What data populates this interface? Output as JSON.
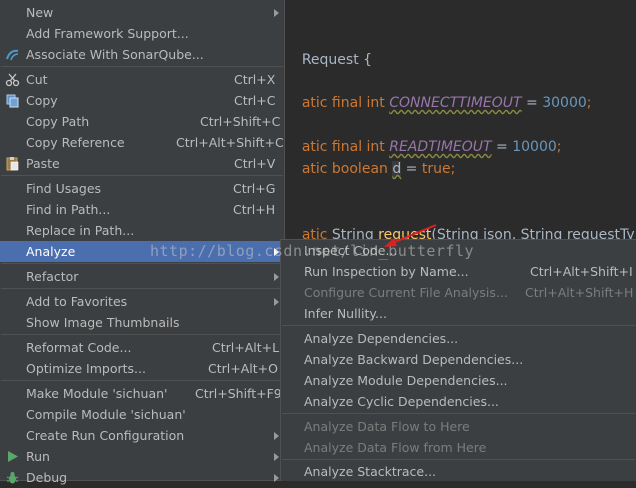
{
  "editor": {
    "line1": "Request {",
    "line2_kw": "atic final int ",
    "line2_const": "CONNECTTIMEOUT",
    "line2_eq": " = ",
    "line2_num": "30000",
    "line2_end": ";",
    "line3_kw": "atic final int ",
    "line3_const": "READTIMEOUT",
    "line3_eq": " = ",
    "line3_num": "10000",
    "line3_end": ";",
    "line4_kw": "atic boolean ",
    "line4_var": "d",
    "line4_eq": " = ",
    "line4_val": "true",
    "line4_end": ";",
    "line5_kw": "atic ",
    "line5_type": "String ",
    "line5_fn": "request",
    "line5_rest": "(String json, String requestType"
  },
  "main_menu": [
    {
      "label": "New",
      "shortcut": "",
      "arrow": true
    },
    {
      "label": "Add Framework Support...",
      "shortcut": ""
    },
    {
      "label": "Associate With SonarQube...",
      "shortcut": "",
      "icon": "sonarqube-icon"
    },
    {
      "label": "Cut",
      "shortcut": "Ctrl+X",
      "icon": "scissors-icon"
    },
    {
      "label": "Copy",
      "shortcut": "Ctrl+C",
      "icon": "copy-icon"
    },
    {
      "label": "Copy Path",
      "shortcut": "Ctrl+Shift+C"
    },
    {
      "label": "Copy Reference",
      "shortcut": "Ctrl+Alt+Shift+C"
    },
    {
      "label": "Paste",
      "shortcut": "Ctrl+V",
      "icon": "paste-icon"
    },
    {
      "label": "Find Usages",
      "shortcut": "Ctrl+G"
    },
    {
      "label": "Find in Path...",
      "shortcut": "Ctrl+H"
    },
    {
      "label": "Replace in Path...",
      "shortcut": ""
    },
    {
      "label": "Analyze",
      "shortcut": "",
      "arrow": true,
      "selected": true
    },
    {
      "label": "Refactor",
      "shortcut": "",
      "arrow": true
    },
    {
      "label": "Add to Favorites",
      "shortcut": "",
      "arrow": true
    },
    {
      "label": "Show Image Thumbnails",
      "shortcut": ""
    },
    {
      "label": "Reformat Code...",
      "shortcut": "Ctrl+Alt+L"
    },
    {
      "label": "Optimize Imports...",
      "shortcut": "Ctrl+Alt+O"
    },
    {
      "label": "Make Module 'sichuan'",
      "shortcut": "Ctrl+Shift+F9"
    },
    {
      "label": "Compile Module 'sichuan'",
      "shortcut": ""
    },
    {
      "label": "Create Run Configuration",
      "shortcut": "",
      "arrow": true
    },
    {
      "label": "Run",
      "shortcut": "",
      "arrow": true,
      "icon": "run-icon"
    },
    {
      "label": "Debug",
      "shortcut": "",
      "arrow": true,
      "icon": "debug-icon"
    }
  ],
  "sub_menu": [
    {
      "label": "Inspect Code...",
      "shortcut": ""
    },
    {
      "label": "Run Inspection by Name...",
      "shortcut": "Ctrl+Alt+Shift+I"
    },
    {
      "label": "Configure Current File Analysis...",
      "shortcut": "Ctrl+Alt+Shift+H",
      "disabled": true
    },
    {
      "label": "Infer Nullity...",
      "shortcut": ""
    },
    {
      "label": "Analyze Dependencies...",
      "shortcut": ""
    },
    {
      "label": "Analyze Backward Dependencies...",
      "shortcut": ""
    },
    {
      "label": "Analyze Module Dependencies...",
      "shortcut": ""
    },
    {
      "label": "Analyze Cyclic Dependencies...",
      "shortcut": ""
    },
    {
      "label": "Analyze Data Flow to Here",
      "shortcut": "",
      "disabled": true
    },
    {
      "label": "Analyze Data Flow from Here",
      "shortcut": "",
      "disabled": true
    },
    {
      "label": "Analyze Stacktrace...",
      "shortcut": ""
    }
  ],
  "watermark": "http://blog.csdn.net/lin_butterfly",
  "colors": {
    "menu_bg": "#3c3f41",
    "selected_bg": "#4b6eaf",
    "text": "#bbbbbb",
    "disabled": "#7c7c7c",
    "annotation": "#e02020"
  }
}
